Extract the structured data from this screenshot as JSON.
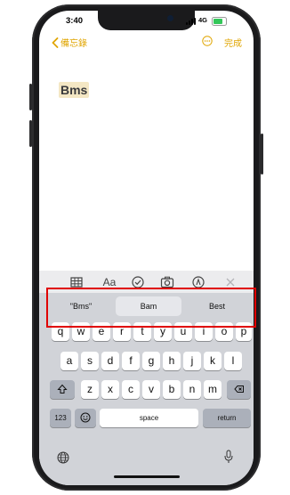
{
  "status_bar": {
    "time": "3:40",
    "network": "4G"
  },
  "nav": {
    "back_label": "備忘錄",
    "done_label": "完成"
  },
  "note": {
    "title": "Bms"
  },
  "toolbar": {
    "text_format_label": "Aa"
  },
  "suggestions": [
    "\"Bms\"",
    "Bam",
    "Best"
  ],
  "keyboard": {
    "row1": [
      "q",
      "w",
      "e",
      "r",
      "t",
      "y",
      "u",
      "i",
      "o",
      "p"
    ],
    "row2": [
      "a",
      "s",
      "d",
      "f",
      "g",
      "h",
      "j",
      "k",
      "l"
    ],
    "row3": [
      "z",
      "x",
      "c",
      "v",
      "b",
      "n",
      "m"
    ],
    "numbers_label": "123",
    "space_label": "space",
    "return_label": "return"
  },
  "colors": {
    "accent": "#e0a500",
    "highlight_box": "#e00000",
    "keyboard_bg": "#d1d3d8"
  }
}
